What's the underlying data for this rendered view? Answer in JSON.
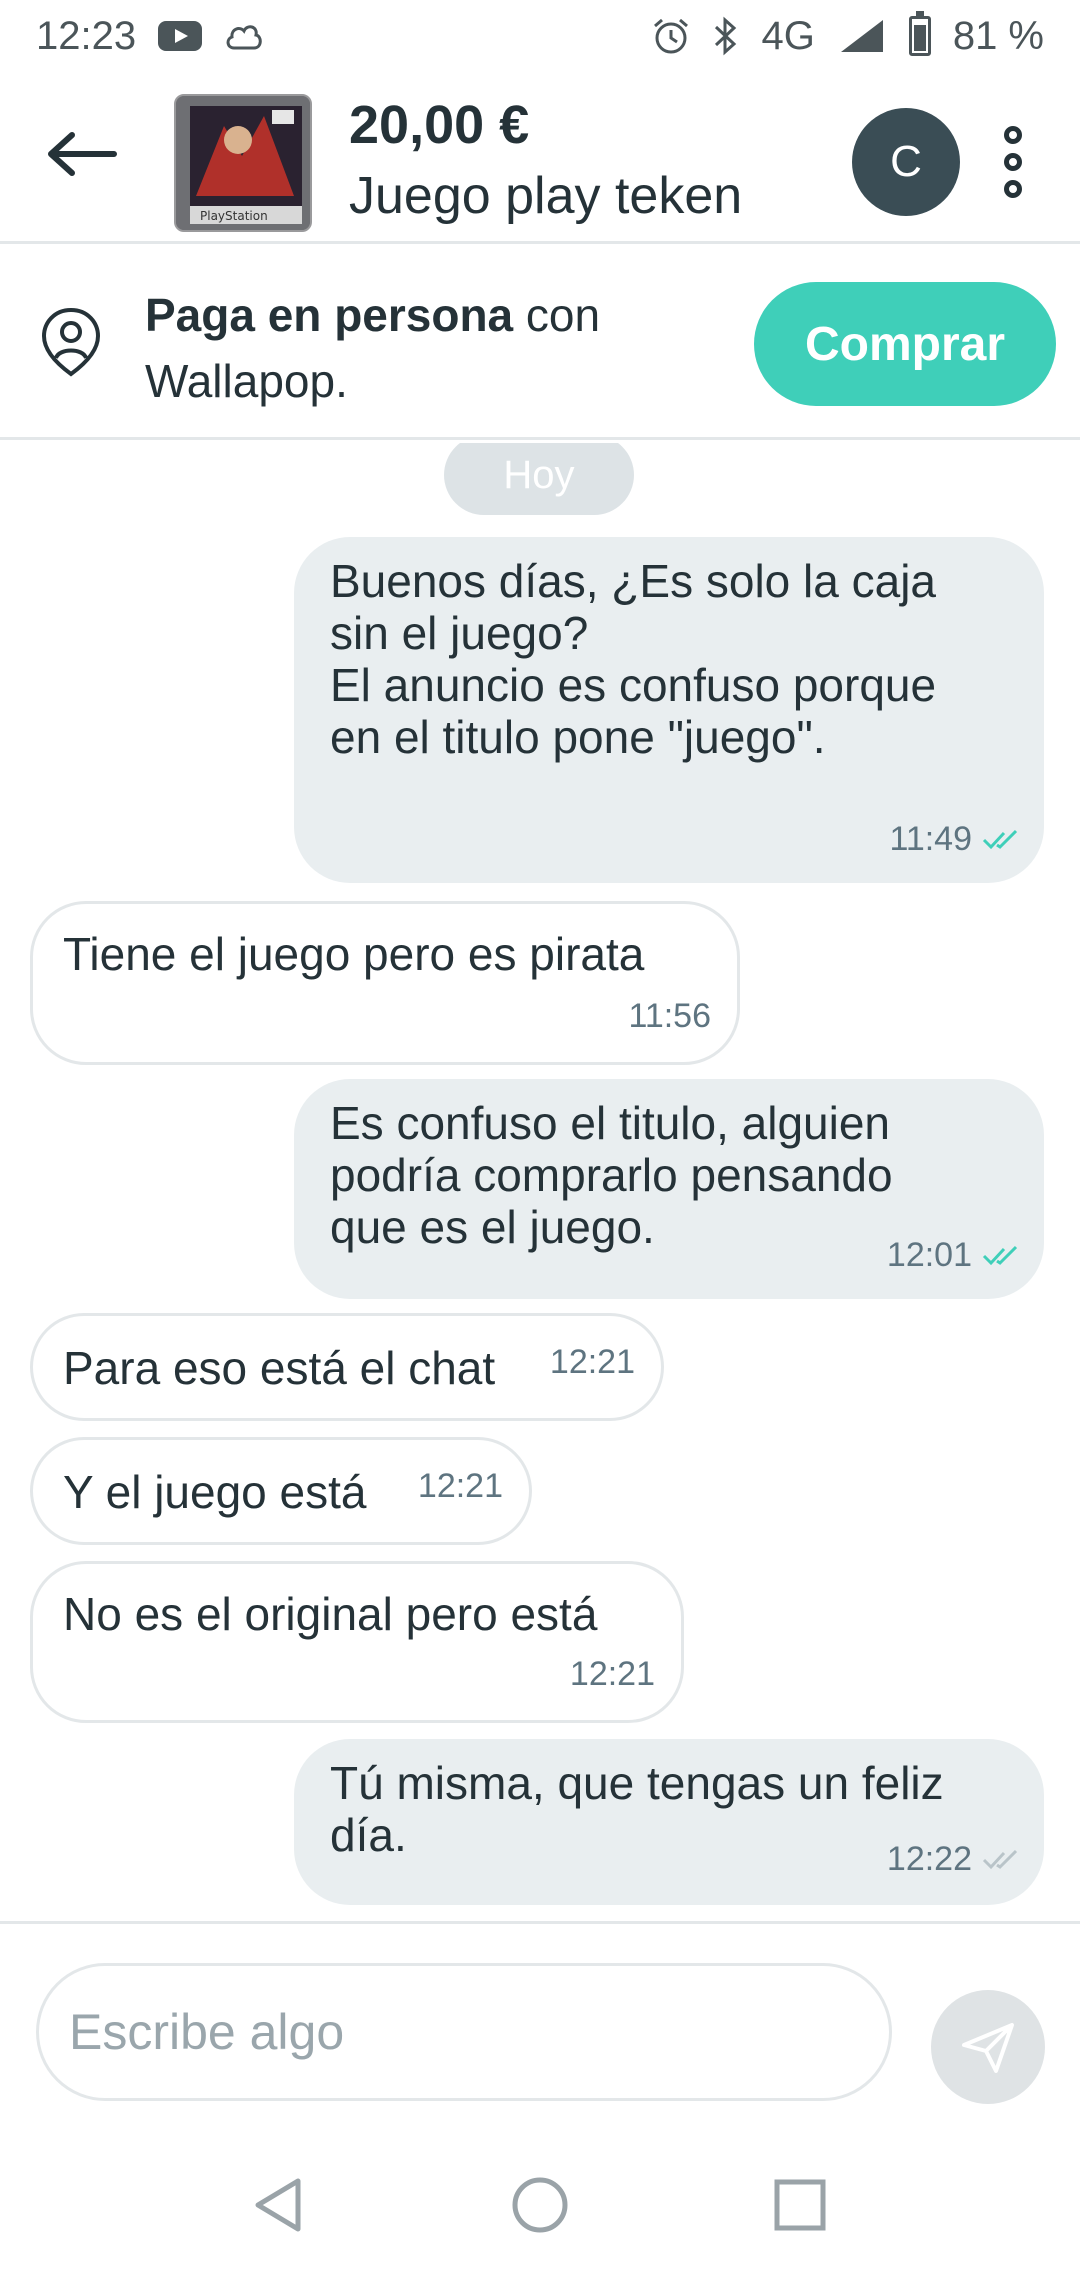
{
  "status_bar": {
    "time": "12:23",
    "network": "4G",
    "battery": "81 %",
    "icons": [
      "youtube-icon",
      "cloud-icon",
      "alarm-icon",
      "bluetooth-icon",
      "signal-icon",
      "battery-icon"
    ]
  },
  "header": {
    "price": "20,00 €",
    "title": "Juego play teken",
    "avatar_initial": "C",
    "thumb_label": "PlayStation"
  },
  "banner": {
    "bold": "Paga en persona",
    "rest": " con Wallapop.",
    "buy_label": "Comprar",
    "accent_color": "#3fcfb9"
  },
  "chat": {
    "day_label": "Hoy",
    "messages": [
      {
        "direction": "out",
        "text": "Buenos días, ¿Es solo la caja\nsin el juego?\nEl anuncio es confuso porque\nen el titulo pone \"juego\".",
        "time": "11:49",
        "read": true
      },
      {
        "direction": "in",
        "text": "Tiene el juego pero es pirata",
        "time": "11:56"
      },
      {
        "direction": "out",
        "text": "Es confuso el titulo, alguien\npodría comprarlo pensando\nque es el juego.",
        "time": "12:01",
        "read": true
      },
      {
        "direction": "in",
        "text": "Para eso está el chat",
        "time": "12:21"
      },
      {
        "direction": "in",
        "text": "Y el juego está",
        "time": "12:21"
      },
      {
        "direction": "in",
        "text": "No es el original pero está",
        "time": "12:21"
      },
      {
        "direction": "out",
        "text": "Tú misma, que tengas un feliz\ndía.",
        "time": "12:22",
        "read": false
      }
    ]
  },
  "composer": {
    "placeholder": "Escribe algo",
    "value": ""
  }
}
